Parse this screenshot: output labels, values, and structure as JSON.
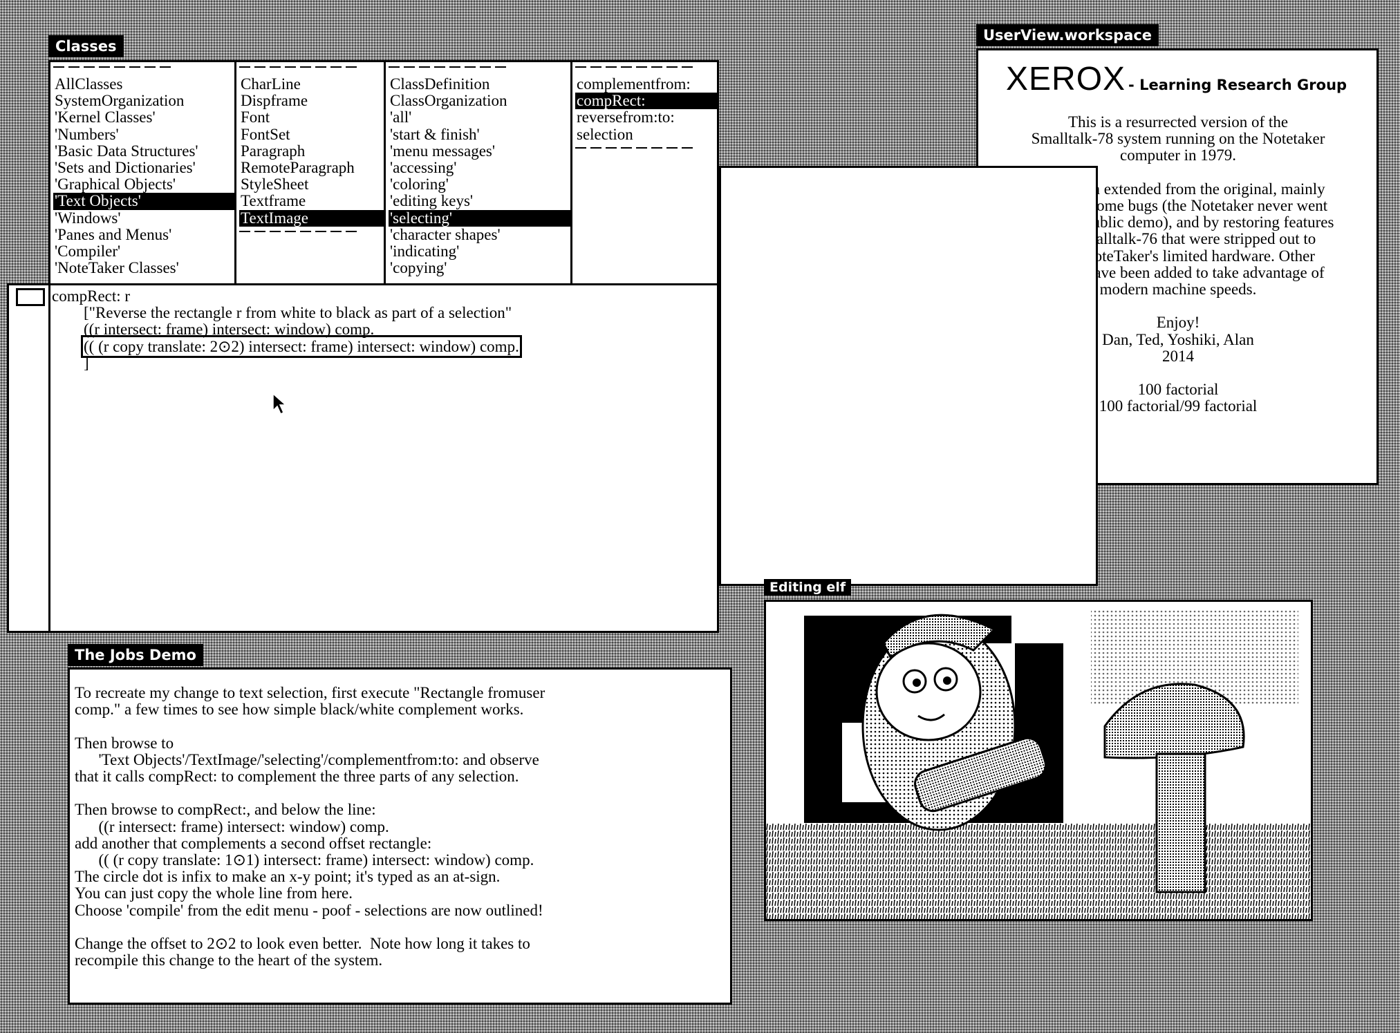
{
  "classes_window": {
    "title": "Classes",
    "categories": [
      "AllClasses",
      "SystemOrganization",
      "'Kernel Classes'",
      "'Numbers'",
      "'Basic Data Structures'",
      "'Sets and Dictionaries'",
      "'Graphical Objects'",
      "'Text Objects'",
      "'Windows'",
      "'Panes and Menus'",
      "'Compiler'",
      "'NoteTaker Classes'"
    ],
    "categories_selected": "'Text Objects'",
    "classes": [
      "CharLine",
      "Dispframe",
      "Font",
      "FontSet",
      "Paragraph",
      "RemoteParagraph",
      "StyleSheet",
      "Textframe",
      "TextImage"
    ],
    "classes_selected": "TextImage",
    "protocols": [
      "ClassDefinition",
      "ClassOrganization",
      "'all'",
      "'start & finish'",
      "'menu messages'",
      "'accessing'",
      "'coloring'",
      "'editing keys'",
      "'selecting'",
      "'character shapes'",
      "'indicating'",
      "'copying'"
    ],
    "protocols_selected": "'selecting'",
    "messages": [
      "complementfrom:",
      "compRect:",
      "reversefrom:to:",
      "selection"
    ],
    "messages_selected": "compRect:",
    "code": {
      "line1": "compRect: r",
      "line2": "        [\"Reverse the rectangle r from white to black as part of a selection\"",
      "line3": "        ((r intersect: frame) intersect: window) comp.",
      "line4": "(( (r copy translate: 2⊙2) intersect: frame) intersect: window) comp.",
      "line5": "        ]"
    }
  },
  "workspace_window": {
    "title": "UserView.workspace",
    "brand": "XEROX",
    "brand_sub": "- Learning Research Group",
    "text": "This is a resurrected version of the\nSmalltalk-78 system running on the Notetaker\ncomputer in 1979.\n\n      It has been extended from the original, mainly\n  by fixing some bugs (the Notetaker never went\n  beyond a public demo), and by restoring features\n  from Smalltalk-76 that were stripped out to\n  fit the NoteTaker's limited hardware.  Other\n  features have been added to take advantage of\n  modern machine speeds.\n\n                    Enjoy!\n        Dan, Ted, Yoshiki, Alan\n                      2014\n\n                 100 factorial\n         100 factorial/99 factorial"
  },
  "jobs_window": {
    "title": "The Jobs Demo",
    "text": "To recreate my change to text selection, first execute \"Rectangle fromuser\ncomp.\" a few times to see how simple black/white complement works.\n\nThen browse to\n      'Text Objects'/TextImage/'selecting'/complementfrom:to: and observe\nthat it calls compRect: to complement the three parts of any selection.\n\nThen browse to compRect:, and below the line:\n      ((r intersect: frame) intersect: window) comp.\nadd another that complements a second offset rectangle:\n      (( (r copy translate: 1⊙1) intersect: frame) intersect: window) comp.\nThe circle dot is infix to make an x-y point; it's typed as an at-sign.\nYou can just copy the whole line from here.\nChoose 'compile' from the edit menu - poof - selections are now outlined!\n\nChange the offset to 2⊙2 to look even better.  Note how long it takes to\nrecompile this change to the heart of the system."
  },
  "picture_window": {
    "title": "Editing elf"
  }
}
